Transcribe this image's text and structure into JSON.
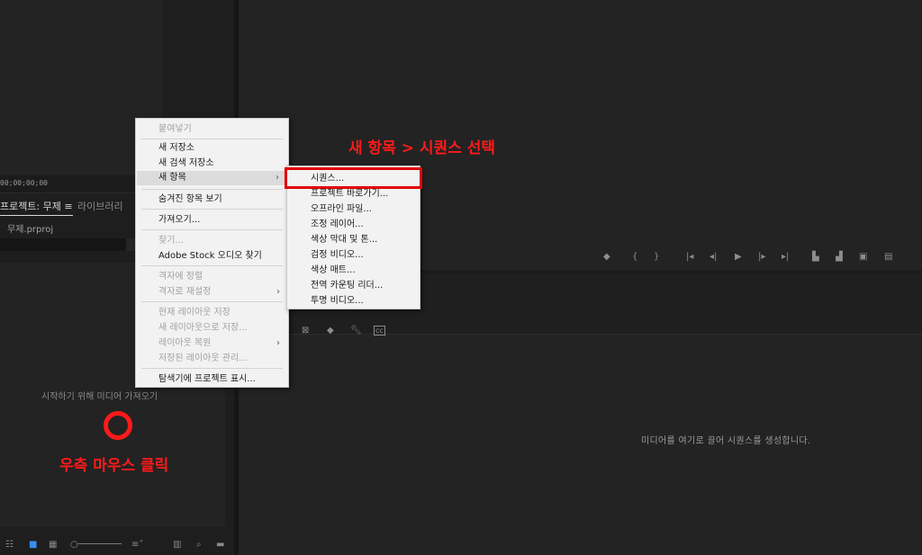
{
  "project_panel": {
    "timecode": "00;00;00;00",
    "tab_project": "프로젝트: 무제 ≡",
    "tab_library": "라이브러리",
    "file_name": "무제.prproj",
    "import_hint": "시작하기 위해 미디어 가져오기"
  },
  "timeline": {
    "drop_hint": "미디어를 여기로 끌어 시퀀스를 생성합니다."
  },
  "context_menu": {
    "paste": "붙여넣기",
    "new_bin": "새 저장소",
    "new_search_bin": "새 검색 저장소",
    "new_item": "새 항목",
    "show_hidden": "숨겨진 항목 보기",
    "import": "가져오기...",
    "find": "찾기...",
    "adobe_stock": "Adobe Stock 오디오 찾기",
    "align_grid": "격자에 정렬",
    "reset_grid": "격자로 재설정",
    "save_layout": "현재 레이아웃 저장",
    "save_layout_as": "새 레이아웃으로 저장...",
    "restore_layout": "레이아웃 복원",
    "manage_layouts": "저장된 레이아웃 관리...",
    "reveal_explorer": "탐색기에 프로젝트 표시..."
  },
  "submenu": {
    "items": [
      "시퀀스...",
      "프로젝트 바로가기...",
      "오프라인 파일...",
      "조정 레이어...",
      "색상 막대 및 톤...",
      "검정 비디오...",
      "색상 매트...",
      "전역 카운팅 리더...",
      "투명 비디오..."
    ]
  },
  "annotations": {
    "right_click": "우측 마우스 클릭",
    "select_sequence": "새 항목 > 시퀀스 선택"
  }
}
